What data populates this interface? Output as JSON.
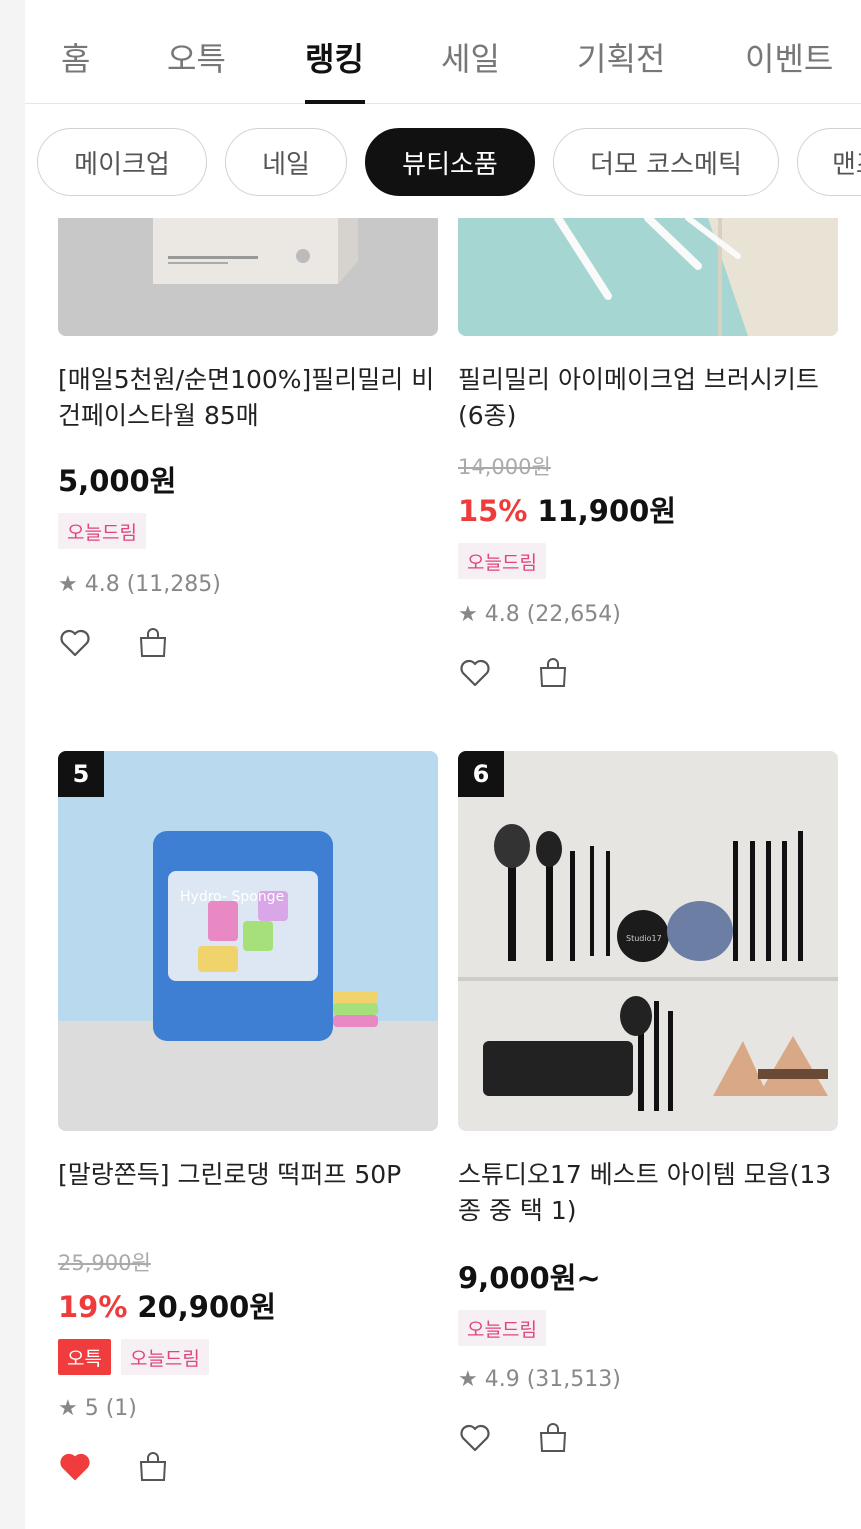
{
  "tabs": [
    {
      "label": "홈",
      "active": false
    },
    {
      "label": "오특",
      "active": false
    },
    {
      "label": "랭킹",
      "active": true
    },
    {
      "label": "세일",
      "active": false
    },
    {
      "label": "기획전",
      "active": false
    },
    {
      "label": "이벤트",
      "active": false
    }
  ],
  "chips": [
    {
      "label": "메이크업",
      "active": false
    },
    {
      "label": "네일",
      "active": false
    },
    {
      "label": "뷰티소품",
      "active": true
    },
    {
      "label": "더모 코스메틱",
      "active": false
    },
    {
      "label": "맨즈케어",
      "active": false
    }
  ],
  "products": [
    {
      "name": "[매일5천원/순면100%]필리밀리 비건페이스타월 85매",
      "price": "5,000원",
      "badges": [
        "오늘드림"
      ],
      "rating": "4.8 (11,285)",
      "liked": false
    },
    {
      "name": "필리밀리 아이메이크업 브러시키트(6종)",
      "original_price": "14,000원",
      "discount": "15%",
      "price": "11,900원",
      "badges": [
        "오늘드림"
      ],
      "rating": "4.8 (22,654)",
      "liked": false
    },
    {
      "rank": "5",
      "name": "[말랑쫀득] 그린로댕 떡퍼프 50P",
      "original_price": "25,900원",
      "discount": "19%",
      "price": "20,900원",
      "badges_special": "오특",
      "badges": [
        "오늘드림"
      ],
      "rating": "5 (1)",
      "liked": true,
      "image_text": "Hydro- Sponge"
    },
    {
      "rank": "6",
      "name": "스튜디오17 베스트 아이템 모음(13종 중 택 1)",
      "price": "9,000원~",
      "badges": [
        "오늘드림"
      ],
      "rating": "4.9 (31,513)",
      "liked": false,
      "image_text": "Studio17"
    }
  ],
  "colors": {
    "accent": "#111111",
    "discount": "#ee3b3b",
    "today_badge_text": "#e0467a",
    "heart_liked": "#f03c3c"
  }
}
